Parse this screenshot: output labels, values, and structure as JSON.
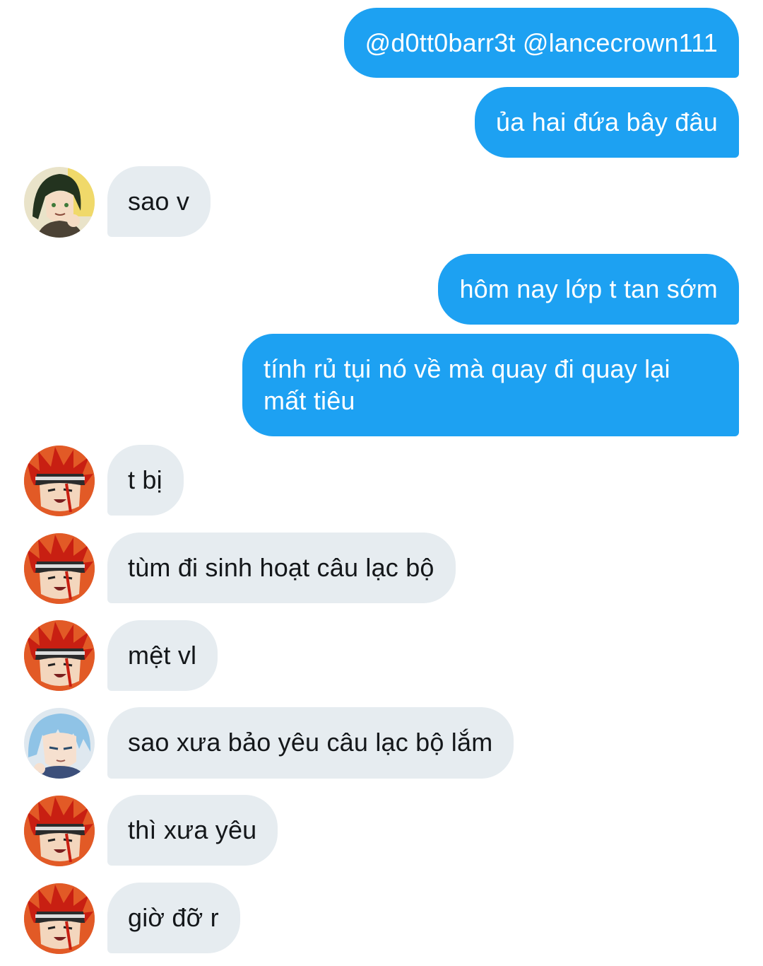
{
  "messages": [
    {
      "side": "sent",
      "text": "@d0tt0barr3t @lancecrown111"
    },
    {
      "side": "sent",
      "text": "ủa hai đứa bây đâu"
    },
    {
      "side": "received",
      "avatar": "green-hair-avatar-icon",
      "text": "sao v"
    },
    {
      "side": "sent",
      "text": "hôm nay lớp t tan sớm"
    },
    {
      "side": "sent",
      "text": "tính rủ tụi nó về mà quay đi quay lại mất tiêu"
    },
    {
      "side": "received",
      "avatar": "red-hair-avatar-icon",
      "text": "t bị"
    },
    {
      "side": "received",
      "avatar": "red-hair-avatar-icon",
      "text": "tùm đi sinh hoạt câu lạc bộ"
    },
    {
      "side": "received",
      "avatar": "red-hair-avatar-icon",
      "text": "mệt vl"
    },
    {
      "side": "received",
      "avatar": "blue-hair-avatar-icon",
      "text": "sao xưa bảo yêu câu lạc bộ lắm"
    },
    {
      "side": "received",
      "avatar": "red-hair-avatar-icon",
      "text": "thì xưa yêu"
    },
    {
      "side": "received",
      "avatar": "red-hair-avatar-icon",
      "text": "giờ đỡ r"
    }
  ],
  "colors": {
    "sent_bubble": "#1da1f2",
    "received_bubble": "#e6ecf0",
    "sent_text": "#ffffff",
    "received_text": "#14171a"
  }
}
